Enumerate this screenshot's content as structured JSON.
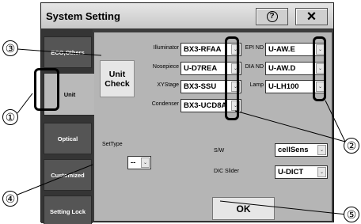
{
  "window": {
    "title": "System Setting",
    "help_icon": "?",
    "close_icon": "×"
  },
  "sidebar": {
    "items": [
      {
        "label": "ECO,Others"
      },
      {
        "label": "Unit"
      },
      {
        "label": "Optical"
      },
      {
        "label": "Customized"
      },
      {
        "label": "Setting Lock"
      }
    ],
    "active": "Unit"
  },
  "unit_panel": {
    "unit_check": "Unit\nCheck",
    "fields": [
      {
        "label": "Illuminator",
        "value": "BX3-RFAA"
      },
      {
        "label": "Nosepiece",
        "value": "U-D7REA"
      },
      {
        "label": "XYStage",
        "value": "BX3-SSU"
      },
      {
        "label": "Condenser",
        "value": "BX3-UCD8A"
      },
      {
        "label": "EPI ND",
        "value": "U-AW.E"
      },
      {
        "label": "DIA ND",
        "value": "U-AW.D"
      },
      {
        "label": "Lamp",
        "value": "U-LH100"
      }
    ],
    "settype": {
      "label": "SetType",
      "value": "--"
    },
    "sw": {
      "label": "S/W",
      "value": "cellSens"
    },
    "dic": {
      "label": "DIC Slider",
      "value": "U-DICT"
    },
    "ok": "OK"
  },
  "callouts": [
    "①",
    "②",
    "③",
    "④",
    "⑤"
  ],
  "colors": {
    "window_bg": "#3c3c3c",
    "panel_bg": "#b5b5b5",
    "active_tab": "#b9b9b9"
  }
}
